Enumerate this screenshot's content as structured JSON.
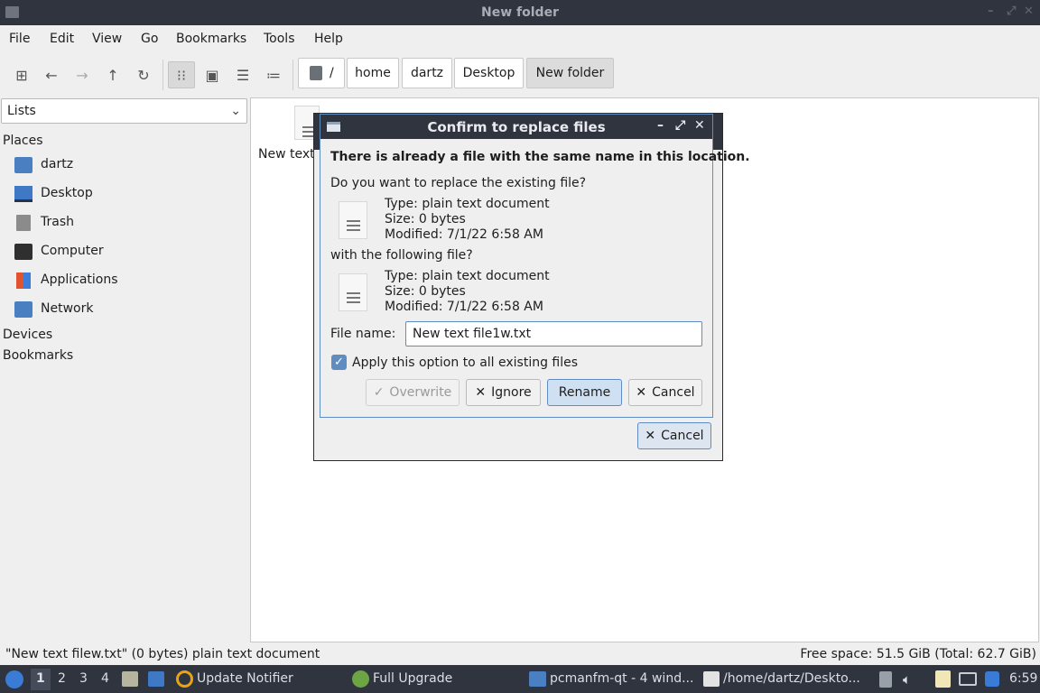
{
  "window": {
    "title": "New folder"
  },
  "menu": [
    "File",
    "Edit",
    "View",
    "Go",
    "Bookmarks",
    "Tools",
    "Help"
  ],
  "path": [
    "/",
    "home",
    "dartz",
    "Desktop",
    "New folder"
  ],
  "sidebar": {
    "combo": "Lists",
    "places_header": "Places",
    "places": [
      "dartz",
      "Desktop",
      "Trash",
      "Computer",
      "Applications",
      "Network"
    ],
    "devices_header": "Devices",
    "bookmarks_header": "Bookmarks"
  },
  "content": {
    "partial_file_label": "New text"
  },
  "dialog": {
    "title": "Confirm to replace files",
    "heading": "There is already a file with the same name in this location.",
    "question": "Do you want to replace the existing file?",
    "existing": {
      "type": "Type: plain text document",
      "size": "Size: 0 bytes",
      "modified": "Modified: 7/1/22 6:58 AM"
    },
    "with_label": "with the following file?",
    "new": {
      "type": "Type: plain text document",
      "size": "Size: 0 bytes",
      "modified": "Modified: 7/1/22 6:58 AM"
    },
    "filename_label": "File name:",
    "filename_value": "New text file1w.txt",
    "apply_all": "Apply this option to all existing files",
    "apply_all_checked": true,
    "buttons": {
      "overwrite": "Overwrite",
      "ignore": "Ignore",
      "rename": "Rename",
      "cancel": "Cancel"
    }
  },
  "progress_dialog": {
    "cancel": "Cancel"
  },
  "status": {
    "left": "\"New text filew.txt\" (0 bytes) plain text document",
    "right": "Free space: 51.5 GiB (Total: 62.7 GiB)"
  },
  "taskbar": {
    "workspaces": [
      "1",
      "2",
      "3",
      "4"
    ],
    "tasks": [
      "Update Notifier",
      "Full Upgrade",
      "pcmanfm-qt - 4 wind...",
      "/home/dartz/Deskto..."
    ],
    "clock": "6:59"
  }
}
